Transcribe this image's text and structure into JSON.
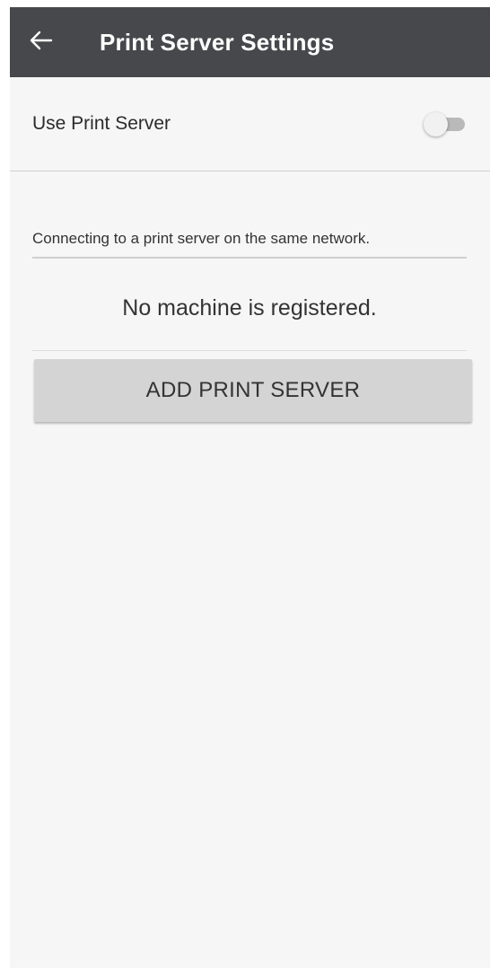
{
  "header": {
    "title": "Print Server Settings",
    "back_icon": "arrow-left-icon"
  },
  "settings": {
    "use_print_server_label": "Use Print Server",
    "use_print_server_enabled": false
  },
  "main": {
    "description": "Connecting to a print server on the same network.",
    "empty_message": "No machine is registered.",
    "add_button_label": "ADD PRINT SERVER"
  },
  "colors": {
    "appbar": "#46484b",
    "background": "#f6f6f6",
    "button": "#d4d4d4"
  }
}
